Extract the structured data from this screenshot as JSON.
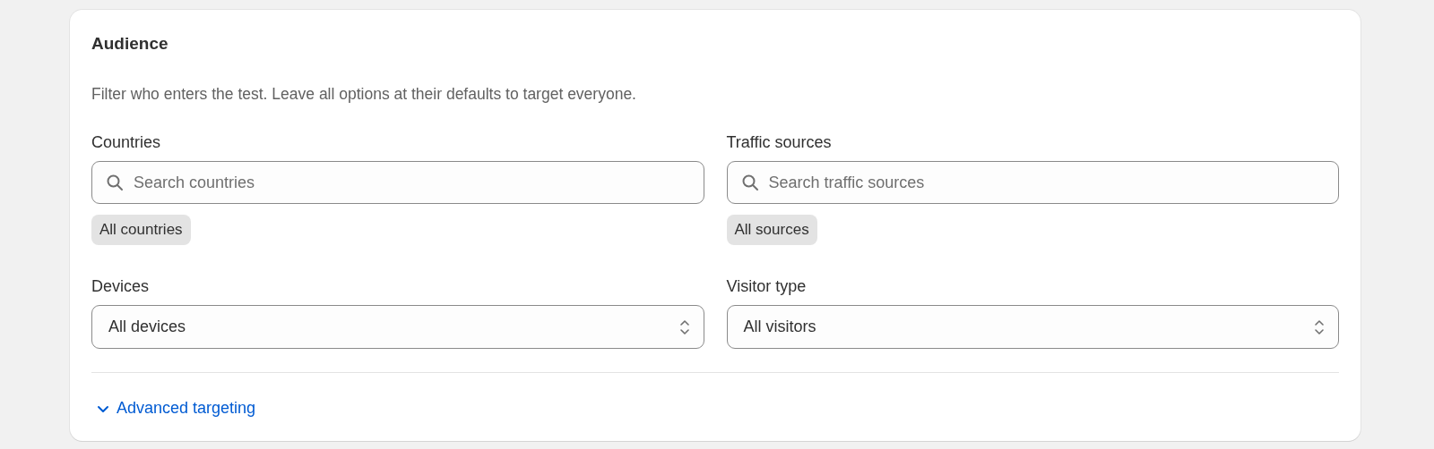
{
  "card": {
    "title": "Audience",
    "description": "Filter who enters the test. Leave all options at their defaults to target everyone.",
    "filters": [
      {
        "kind": "search",
        "label": "Countries",
        "placeholder": "Search countries",
        "chip": "All countries"
      },
      {
        "kind": "search",
        "label": "Traffic sources",
        "placeholder": "Search traffic sources",
        "chip": "All sources"
      },
      {
        "kind": "select",
        "label": "Devices",
        "value": "All devices"
      },
      {
        "kind": "select",
        "label": "Visitor type",
        "value": "All visitors"
      }
    ],
    "advanced": {
      "label": "Advanced targeting",
      "expanded": false
    }
  }
}
